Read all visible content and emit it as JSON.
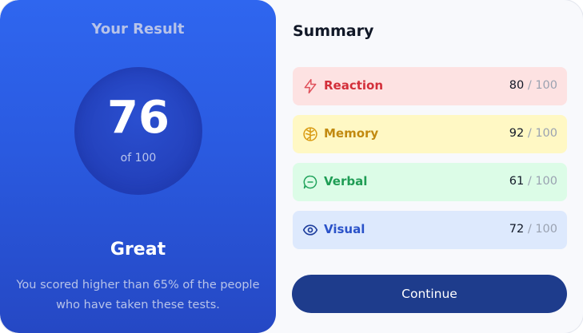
{
  "result": {
    "title": "Your Result",
    "score": "76",
    "score_of": "of 100",
    "rating": "Great",
    "description": "You scored higher than 65% of the people who have taken these tests."
  },
  "summary": {
    "title": "Summary",
    "items": [
      {
        "label": "Reaction",
        "score": "80",
        "max": "/ 100",
        "icon": "lightning-icon",
        "color": "#d32f3a"
      },
      {
        "label": "Memory",
        "score": "92",
        "max": "/ 100",
        "icon": "brain-icon",
        "color": "#c28a10"
      },
      {
        "label": "Verbal",
        "score": "61",
        "max": "/ 100",
        "icon": "chat-bubble-icon",
        "color": "#1f9d55"
      },
      {
        "label": "Visual",
        "score": "72",
        "max": "/ 100",
        "icon": "eye-icon",
        "color": "#2a52c9"
      }
    ]
  },
  "continue_label": "Continue"
}
